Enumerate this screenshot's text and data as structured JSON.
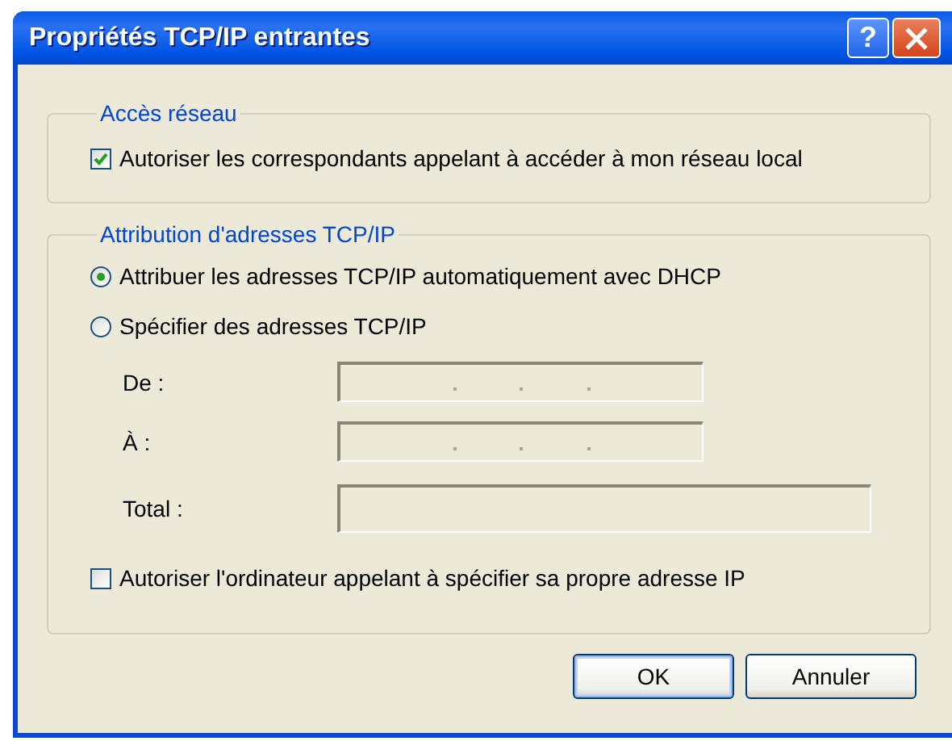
{
  "window": {
    "title": "Propriétés TCP/IP entrantes",
    "help_label": "?"
  },
  "network_access": {
    "legend": "Accès réseau",
    "checkbox": {
      "label": "Autoriser les correspondants appelant à accéder à mon réseau local",
      "checked": true
    }
  },
  "address_assignment": {
    "legend": "Attribution d'adresses TCP/IP",
    "options": [
      {
        "label": "Attribuer les adresses TCP/IP automatiquement avec DHCP",
        "selected": true
      },
      {
        "label": "Spécifier des adresses TCP/IP",
        "selected": false
      }
    ],
    "fields": [
      {
        "label": "De :",
        "kind": "ip",
        "disabled": true
      },
      {
        "label": "À :",
        "kind": "ip",
        "disabled": true
      },
      {
        "label": "Total :",
        "kind": "text",
        "disabled": true
      }
    ],
    "checkbox": {
      "label": "Autoriser l'ordinateur appelant à spécifier sa propre adresse IP",
      "checked": false
    }
  },
  "buttons": [
    {
      "label": "OK",
      "default": true
    },
    {
      "label": "Annuler",
      "default": false
    }
  ]
}
